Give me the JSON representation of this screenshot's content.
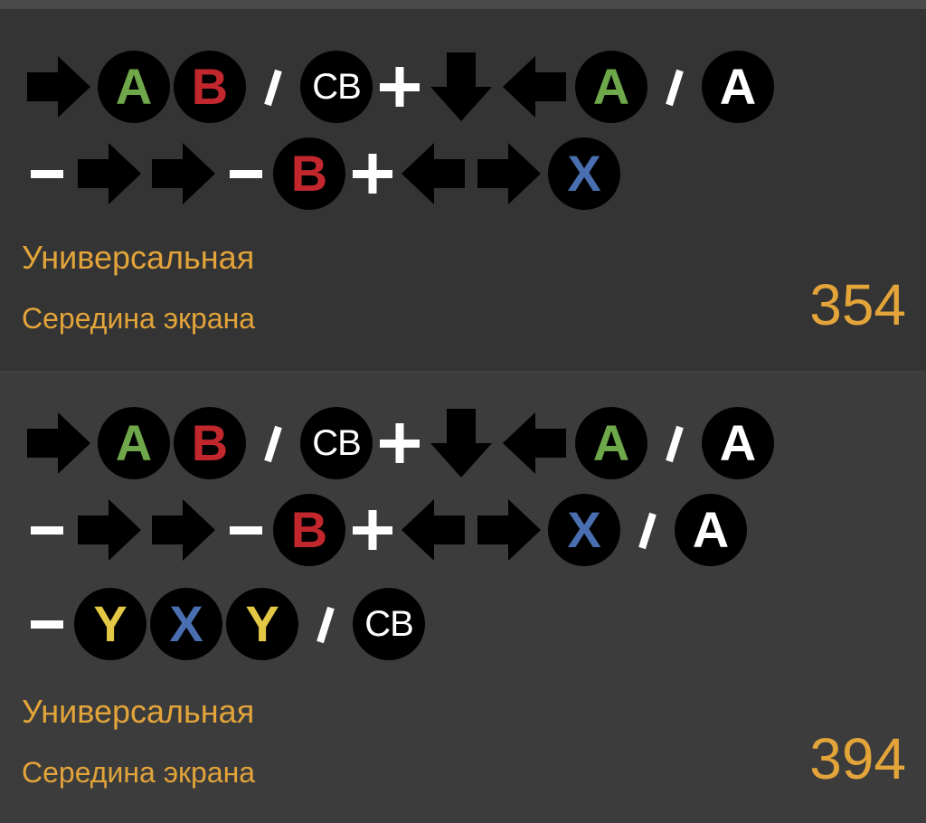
{
  "colors": {
    "accent": "#e3a43a",
    "green": "#6fa84a",
    "red": "#c1272d",
    "blue": "#4a6fb0",
    "yellow": "#e3c845",
    "white": "#ffffff"
  },
  "combos": [
    {
      "category": "Универсальная",
      "position": "Середина экрана",
      "damage": "354",
      "rows": [
        [
          {
            "t": "arrow",
            "dir": "right"
          },
          {
            "t": "btn",
            "label": "A",
            "color": "green"
          },
          {
            "t": "btn",
            "label": "B",
            "color": "red"
          },
          {
            "t": "sep",
            "kind": "slash"
          },
          {
            "t": "btn",
            "label": "CB",
            "color": "white",
            "small": true
          },
          {
            "t": "sep",
            "kind": "plus"
          },
          {
            "t": "arrow",
            "dir": "down"
          },
          {
            "t": "arrow",
            "dir": "left"
          },
          {
            "t": "btn",
            "label": "A",
            "color": "green"
          },
          {
            "t": "sep",
            "kind": "slash"
          },
          {
            "t": "btn",
            "label": "A",
            "color": "white"
          }
        ],
        [
          {
            "t": "sep",
            "kind": "minus"
          },
          {
            "t": "arrow",
            "dir": "right"
          },
          {
            "t": "arrow",
            "dir": "right"
          },
          {
            "t": "sep",
            "kind": "minus"
          },
          {
            "t": "btn",
            "label": "B",
            "color": "red"
          },
          {
            "t": "sep",
            "kind": "plus"
          },
          {
            "t": "arrow",
            "dir": "left"
          },
          {
            "t": "arrow",
            "dir": "right"
          },
          {
            "t": "btn",
            "label": "X",
            "color": "blue"
          }
        ]
      ]
    },
    {
      "category": "Универсальная",
      "position": "Середина экрана",
      "damage": "394",
      "rows": [
        [
          {
            "t": "arrow",
            "dir": "right"
          },
          {
            "t": "btn",
            "label": "A",
            "color": "green"
          },
          {
            "t": "btn",
            "label": "B",
            "color": "red"
          },
          {
            "t": "sep",
            "kind": "slash"
          },
          {
            "t": "btn",
            "label": "CB",
            "color": "white",
            "small": true
          },
          {
            "t": "sep",
            "kind": "plus"
          },
          {
            "t": "arrow",
            "dir": "down"
          },
          {
            "t": "arrow",
            "dir": "left"
          },
          {
            "t": "btn",
            "label": "A",
            "color": "green"
          },
          {
            "t": "sep",
            "kind": "slash"
          },
          {
            "t": "btn",
            "label": "A",
            "color": "white"
          }
        ],
        [
          {
            "t": "sep",
            "kind": "minus"
          },
          {
            "t": "arrow",
            "dir": "right"
          },
          {
            "t": "arrow",
            "dir": "right"
          },
          {
            "t": "sep",
            "kind": "minus"
          },
          {
            "t": "btn",
            "label": "B",
            "color": "red"
          },
          {
            "t": "sep",
            "kind": "plus"
          },
          {
            "t": "arrow",
            "dir": "left"
          },
          {
            "t": "arrow",
            "dir": "right"
          },
          {
            "t": "btn",
            "label": "X",
            "color": "blue"
          },
          {
            "t": "sep",
            "kind": "slash"
          },
          {
            "t": "btn",
            "label": "A",
            "color": "white"
          }
        ],
        [
          {
            "t": "sep",
            "kind": "minus"
          },
          {
            "t": "btn",
            "label": "Y",
            "color": "yellow"
          },
          {
            "t": "btn",
            "label": "X",
            "color": "blue"
          },
          {
            "t": "btn",
            "label": "Y",
            "color": "yellow"
          },
          {
            "t": "sep",
            "kind": "slash"
          },
          {
            "t": "btn",
            "label": "CB",
            "color": "white",
            "small": true
          }
        ]
      ]
    }
  ]
}
